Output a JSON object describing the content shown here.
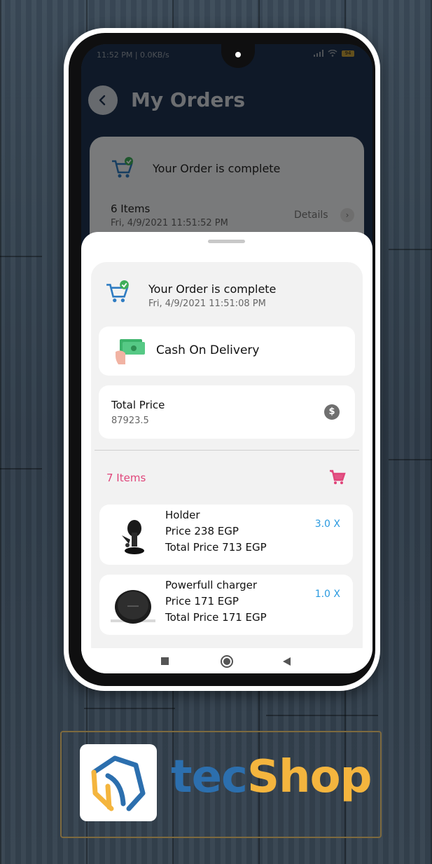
{
  "status_bar": {
    "time_net": "11:52 PM | 0.0KB/s",
    "battery": "94"
  },
  "header": {
    "title": "My Orders"
  },
  "order_card": {
    "status": "Your Order is complete",
    "items": "6 Items",
    "date": "Fri, 4/9/2021 11:51:52 PM",
    "details_label": "Details"
  },
  "sheet": {
    "status": "Your Order is complete",
    "date": "Fri, 4/9/2021 11:51:08 PM",
    "payment": "Cash On Delivery",
    "total_label": "Total Price",
    "total_value": "87923.5",
    "items_count": "7 Items",
    "products": [
      {
        "name": "Holder",
        "price": "Price 238 EGP",
        "total": "Total Price 713 EGP",
        "qty": "3.0 X"
      },
      {
        "name": "Powerfull charger",
        "price": "Price 171 EGP",
        "total": "Total Price 171 EGP",
        "qty": "1.0 X"
      }
    ]
  },
  "brand": {
    "part1": "tec",
    "part2": "Shop"
  },
  "icons": [
    "back-icon",
    "cart-check-icon",
    "cash-icon",
    "dollar-icon",
    "cart-icon",
    "chevron-right-icon"
  ],
  "colors": {
    "accent_pink": "#e0457a",
    "qty_blue": "#2a9ae0",
    "appbar": "#1f3350",
    "brand_blue": "#2c6fae",
    "brand_yellow": "#f4b53e"
  }
}
